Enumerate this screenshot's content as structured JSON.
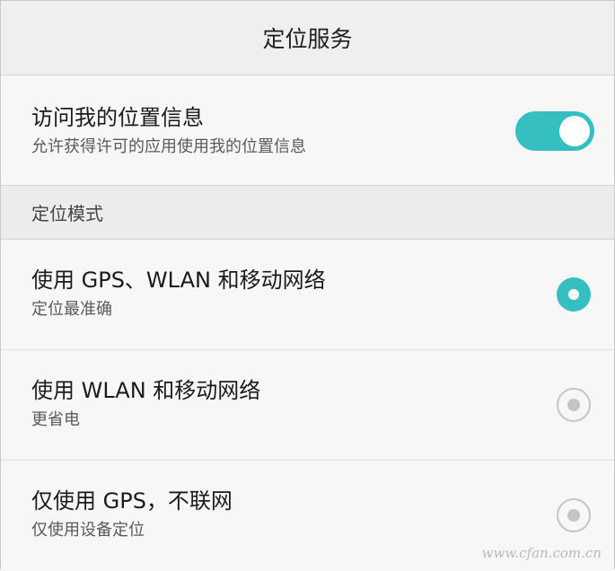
{
  "header": {
    "title": "定位服务"
  },
  "location_access": {
    "title": "访问我的位置信息",
    "subtitle": "允许获得许可的应用使用我的位置信息",
    "enabled": true
  },
  "mode_section": {
    "label": "定位模式"
  },
  "modes": [
    {
      "title": "使用 GPS、WLAN 和移动网络",
      "subtitle": "定位最准确",
      "selected": true
    },
    {
      "title": "使用 WLAN 和移动网络",
      "subtitle": "更省电",
      "selected": false
    },
    {
      "title": "仅使用 GPS，不联网",
      "subtitle": "仅使用设备定位",
      "selected": false
    }
  ],
  "watermark": "www.cfan.com.cn",
  "colors": {
    "accent": "#35bfc0",
    "radio_off": "#c4c4c4",
    "background": "#f7f7f7"
  }
}
